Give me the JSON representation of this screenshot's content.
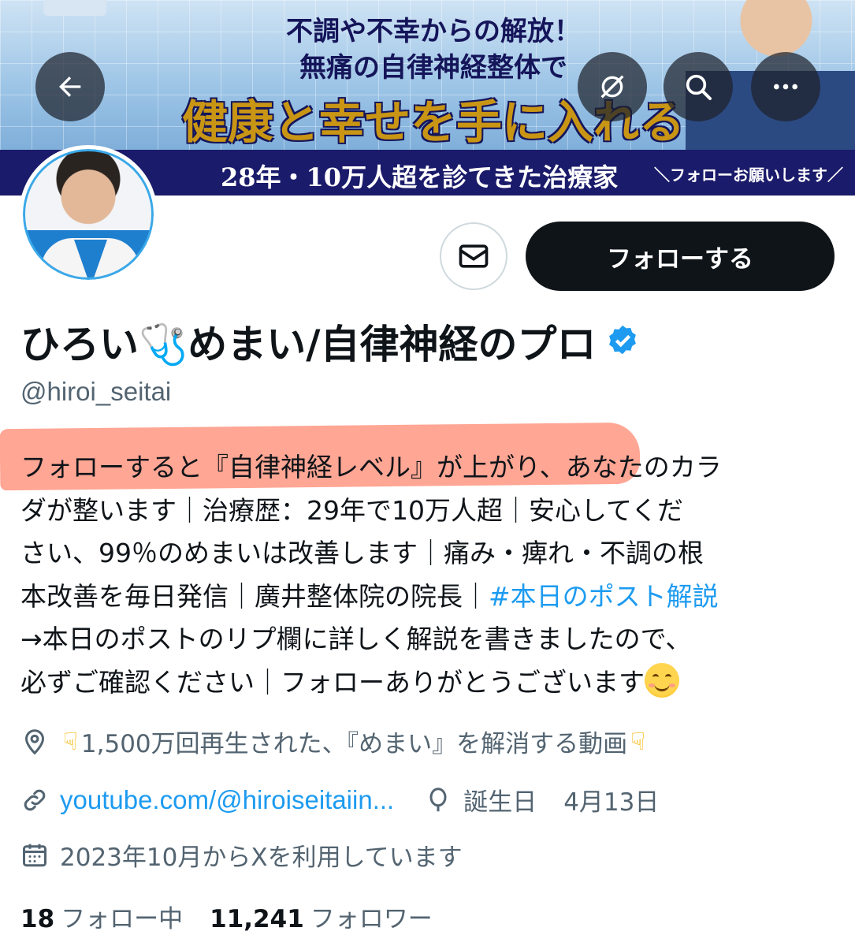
{
  "banner": {
    "line1": "不調や不幸からの解放！",
    "line2": "無痛の自律神経整体で",
    "line3": "健康と幸せを手に入れる",
    "line4": "28年・10万人超を診てきた治療家",
    "line5": "＼フォローお願いします／"
  },
  "actions": {
    "follow_label": "フォローする"
  },
  "profile": {
    "name": "ひろい🩺めまい/自律神経のプロ",
    "handle": "@hiroi_seitai",
    "bio": {
      "line1_highlighted": "フォローすると『自律神経レベル』が上がり、",
      "line1_rest": "あなたのカラ",
      "line2": "ダが整います｜治療歴：29年で10万人超｜安心してくだ",
      "line3": "さい、99％のめまいは改善します｜痛み・痺れ・不調の根",
      "line4_text": "本改善を毎日発信｜廣井整体院の院長｜",
      "line4_hashtag": "#本日のポスト解説",
      "line5": "→本日のポストのリプ欄に詳しく解説を書きましたので、",
      "line6": "必ずご確認ください｜フォローありがとうございます"
    },
    "location": "1,500万回再生された、『めまい』を解消する動画",
    "url": "youtube.com/@hiroiseitaiin...",
    "birthday_label": "誕生日",
    "birthday_value": "4月13日",
    "joined": "2023年10月からXを利用しています",
    "following_count": "18",
    "following_label": "フォロー中",
    "followers_count": "11,241",
    "followers_label": "フォロワー"
  },
  "colors": {
    "accent": "#1d9bf0",
    "highlight": "#ff8d76",
    "follow_button": "#0f1419"
  },
  "icons": [
    "back-arrow-icon",
    "grok-icon",
    "search-icon",
    "more-icon",
    "mail-icon",
    "verified-badge-icon",
    "location-icon",
    "link-icon",
    "balloon-icon",
    "calendar-icon",
    "pointing-down-emoji",
    "smiling-face-emoji"
  ]
}
